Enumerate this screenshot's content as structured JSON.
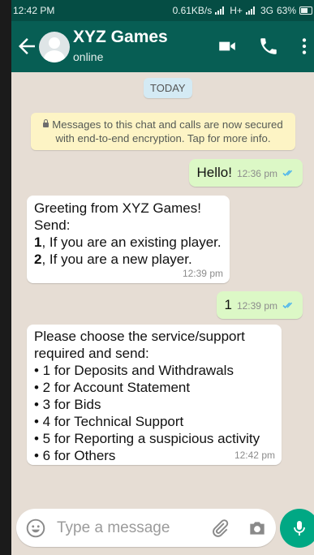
{
  "status_bar": {
    "time": "12:42 PM",
    "network_speed": "0.61KB/s",
    "network_type": "H+",
    "network_type_2": "3G",
    "battery": "63%"
  },
  "header": {
    "title": "XYZ Games",
    "subtitle": "online"
  },
  "chat": {
    "date_chip": "TODAY",
    "security_notice": "Messages to this chat and calls are now secured with end-to-end encryption. Tap for more info.",
    "messages": [
      {
        "direction": "outgoing",
        "text": "Hello!",
        "time": "12:36 pm",
        "status": "read"
      },
      {
        "direction": "incoming",
        "lines": [
          {
            "text": "Greeting from XYZ Games!"
          },
          {
            "text": "Send:"
          },
          {
            "bold": "1",
            "text": ", If you are an existing player."
          },
          {
            "bold": "2",
            "text": ", If you are a new player."
          }
        ],
        "time": "12:39 pm"
      },
      {
        "direction": "outgoing",
        "text": "1",
        "time": "12:39 pm",
        "status": "read"
      },
      {
        "direction": "incoming",
        "lines": [
          "Please choose the service/support",
          "required and send:",
          "• 1 for Deposits and Withdrawals",
          "• 2 for Account Statement",
          "• 3 for Bids",
          "• 4 for Technical Support",
          "• 5 for Reporting a suspicious activity",
          "• 6 for Others"
        ],
        "time": "12:42 pm"
      }
    ]
  },
  "composer": {
    "placeholder": "Type a message"
  },
  "colors": {
    "header": "#075e54",
    "status_bar": "#054d44",
    "outgoing_bubble": "#dcf8c6",
    "incoming_bubble": "#ffffff",
    "chat_background": "#e6ddd4",
    "mic_button": "#00a884",
    "read_ticks": "#4fb6ec"
  },
  "icons": [
    "back-arrow-icon",
    "avatar-icon",
    "video-call-icon",
    "phone-icon",
    "more-options-icon",
    "lock-icon",
    "double-check-icon",
    "emoji-icon",
    "attach-icon",
    "camera-icon",
    "mic-icon"
  ]
}
